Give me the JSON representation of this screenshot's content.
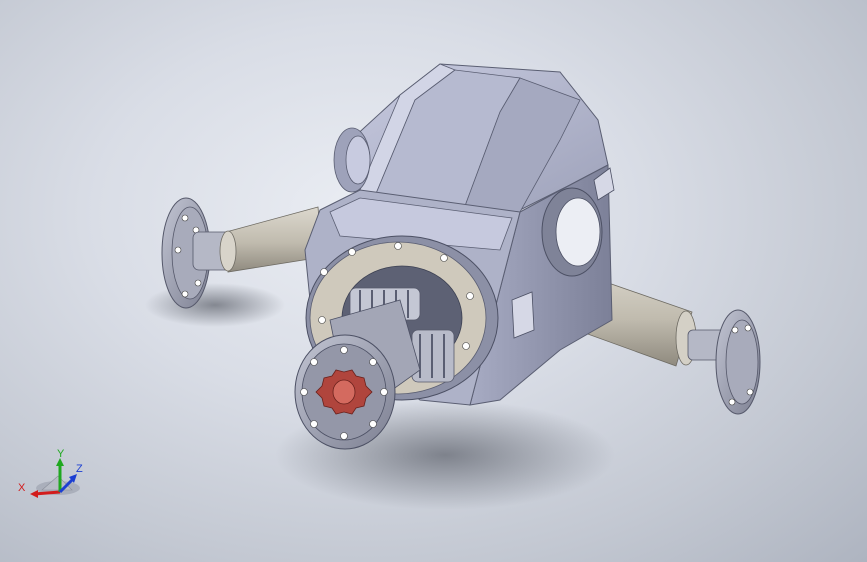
{
  "viewport": {
    "background_colors": [
      "#eaedf3",
      "#aeb4c0"
    ],
    "model_colors": {
      "housing": "#b9bdd2",
      "housing_dark": "#8e92a8",
      "sleeve": "#c9c4b8",
      "flange": "#9fa2b2",
      "spline": "#b0453d"
    }
  },
  "triad": {
    "x_label": "X",
    "y_label": "Y",
    "z_label": "Z",
    "x_color": "#d21c1c",
    "y_color": "#1fa81f",
    "z_color": "#1c3fd2"
  }
}
